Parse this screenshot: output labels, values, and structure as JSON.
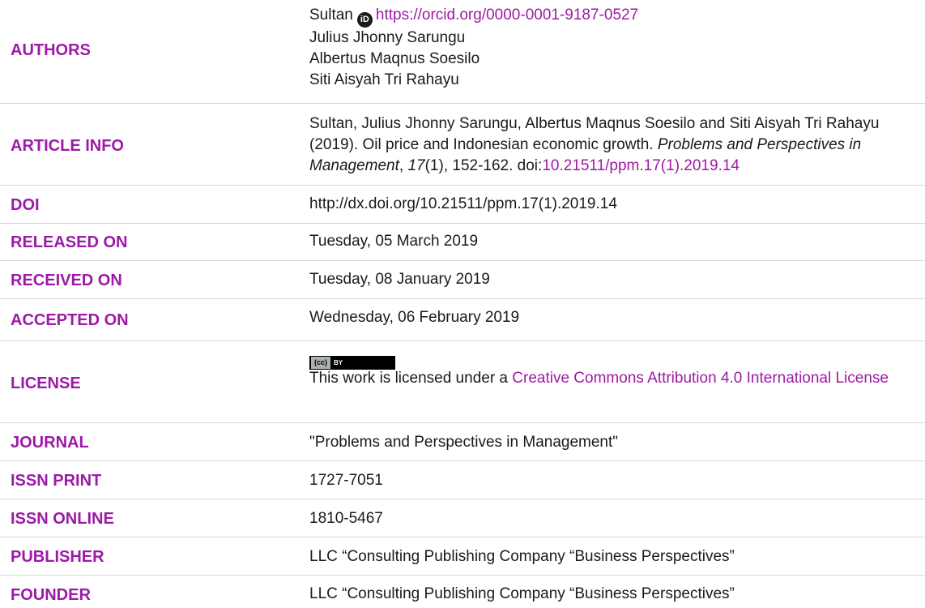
{
  "authors": {
    "label": "AUTHORS",
    "first": "Sultan",
    "orcid_icon": "iD",
    "orcid_url": "https://orcid.org/0000-0001-9187-0527",
    "others": [
      "Julius Jhonny Sarungu",
      "Albertus Maqnus Soesilo",
      "Siti Aisyah Tri Rahayu"
    ]
  },
  "article_info": {
    "label": "ARTICLE INFO",
    "citation_plain_1": "Sultan, Julius Jhonny Sarungu, Albertus Maqnus Soesilo and Siti Aisyah Tri Rahayu (2019). Oil price and Indonesian economic growth. ",
    "citation_italic_1": "Problems and Perspectives in Management",
    "citation_plain_2": ", ",
    "citation_italic_2": "17",
    "citation_plain_3": "(1), 152-162. doi:",
    "citation_doi": "10.21511/ppm.17(1).2019.14"
  },
  "doi": {
    "label": "DOI",
    "value": "http://dx.doi.org/10.21511/ppm.17(1).2019.14"
  },
  "released": {
    "label": "RELEASED ON",
    "value": "Tuesday, 05 March 2019"
  },
  "received": {
    "label": "RECEIVED ON",
    "value": "Tuesday, 08 January 2019"
  },
  "accepted": {
    "label": "ACCEPTED ON",
    "value": "Wednesday, 06 February 2019"
  },
  "license": {
    "label": "LICENSE",
    "badge_cc": "(cc)",
    "badge_by": "BY",
    "text": "This work is licensed under a ",
    "link_text": "Creative Commons Attribution 4.0 International License"
  },
  "journal": {
    "label": "JOURNAL",
    "value": "\"Problems and Perspectives in Management\""
  },
  "issn_print": {
    "label": "ISSN PRINT",
    "value": "1727-7051"
  },
  "issn_online": {
    "label": "ISSN ONLINE",
    "value": "1810-5467"
  },
  "publisher": {
    "label": "PUBLISHER",
    "value": "LLC “Consulting Publishing Company “Business Perspectives”"
  },
  "founder": {
    "label": "FOUNDER",
    "value": "LLC “Consulting Publishing Company “Business Perspectives”"
  },
  "colors": {
    "accent": "#9c1aa6",
    "text": "#1a1a1a",
    "divider": "#d6d6d6"
  }
}
